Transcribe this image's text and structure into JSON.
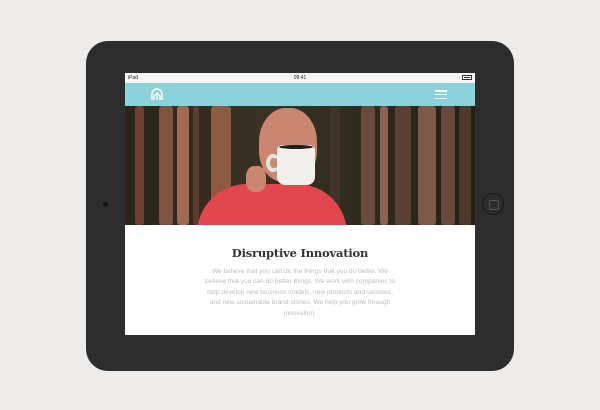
{
  "statusbar": {
    "device": "iPad",
    "time": "09:41"
  },
  "navbar": {
    "background": "#8dd2da",
    "logo_icon": "tree-logo-icon",
    "menu_icon": "hamburger-menu-icon"
  },
  "hero": {
    "description_icon": "hero-photo-man-drinking-from-mug"
  },
  "article": {
    "title": "Disruptive Innovation",
    "body": "We believe that you can do the things that you do better. We believe that you can do better things. We work with companies to help develop new business models, new products and services, and new sustainable brand stories. We help you grow through innovation."
  }
}
